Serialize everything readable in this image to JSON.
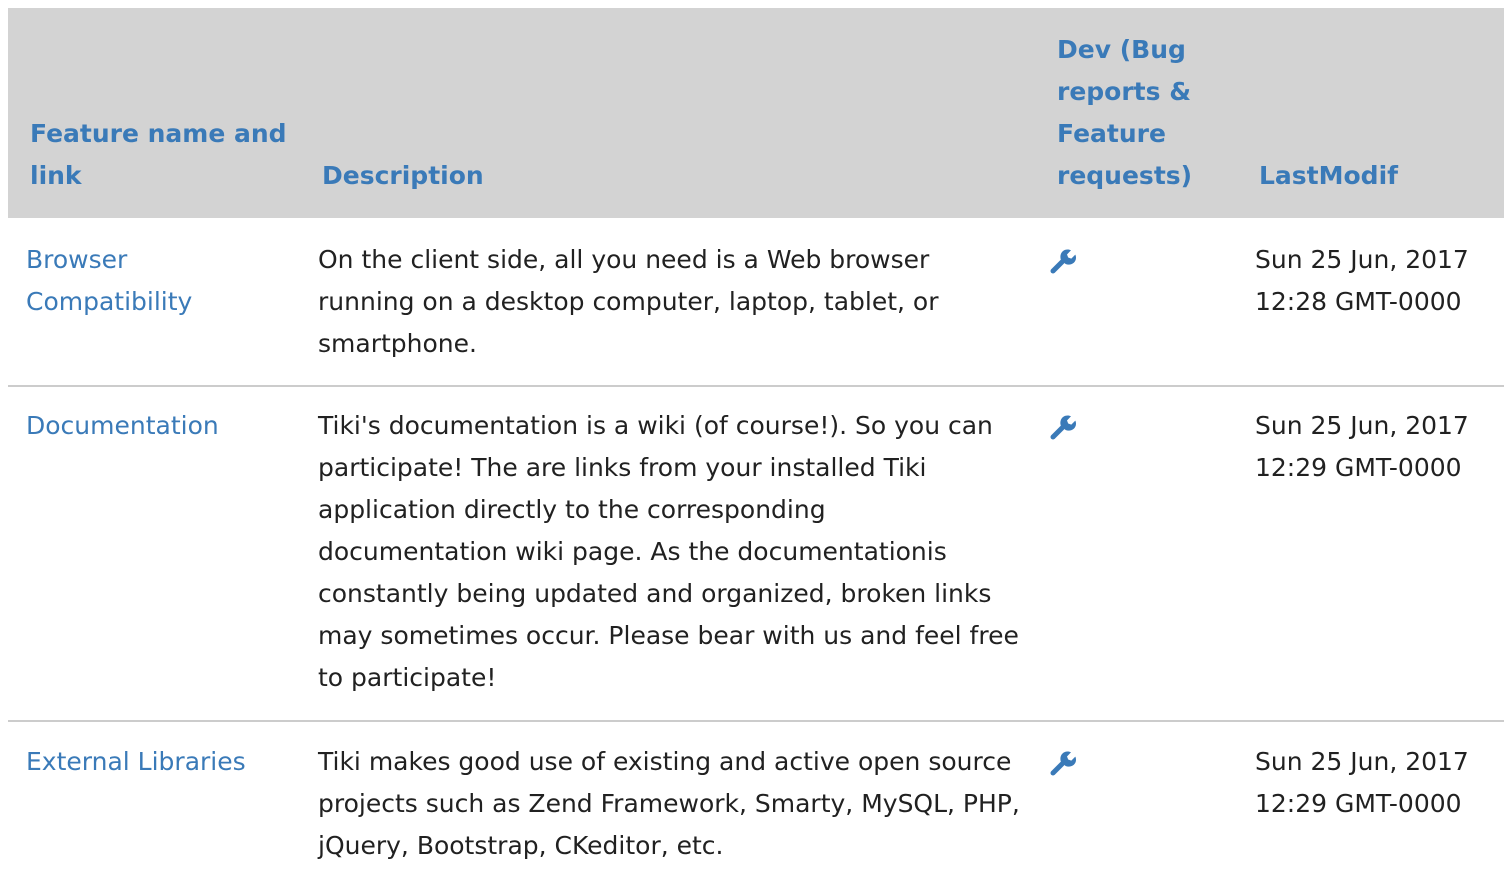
{
  "table": {
    "headers": {
      "feature": "Feature name and link",
      "description": "Description",
      "dev": "Dev (Bug reports & Feature requests)",
      "lastmodif": "LastModif"
    },
    "rows": [
      {
        "feature": "Browser Compatibility",
        "description": "On the client side, all you need is a Web browser running on a desktop computer, laptop, tablet, or smartphone.",
        "dev_icon": "wrench-icon",
        "lastmodif": "Sun 25 Jun, 2017 12:28 GMT-0000"
      },
      {
        "feature": "Documentation",
        "description": "Tiki's documentation is a wiki (of course!). So you can participate! The are links from your installed Tiki application directly to the corresponding documentation wiki page. As the documentationis constantly being updated and organized, broken links may sometimes occur. Please bear with us and feel free to participate!",
        "dev_icon": "wrench-icon",
        "lastmodif": "Sun 25 Jun, 2017 12:29 GMT-0000"
      },
      {
        "feature": "External Libraries",
        "description": "Tiki makes good use of existing and active open source projects such as Zend Framework, Smarty, MySQL, PHP, jQuery, Bootstrap, CKeditor, etc.",
        "dev_icon": "wrench-icon",
        "lastmodif": "Sun 25 Jun, 2017 12:29 GMT-0000"
      }
    ]
  },
  "colors": {
    "link": "#3a7ab8",
    "header_bg": "#d3d3d3",
    "text": "#212121",
    "row_border": "#cccccc"
  }
}
